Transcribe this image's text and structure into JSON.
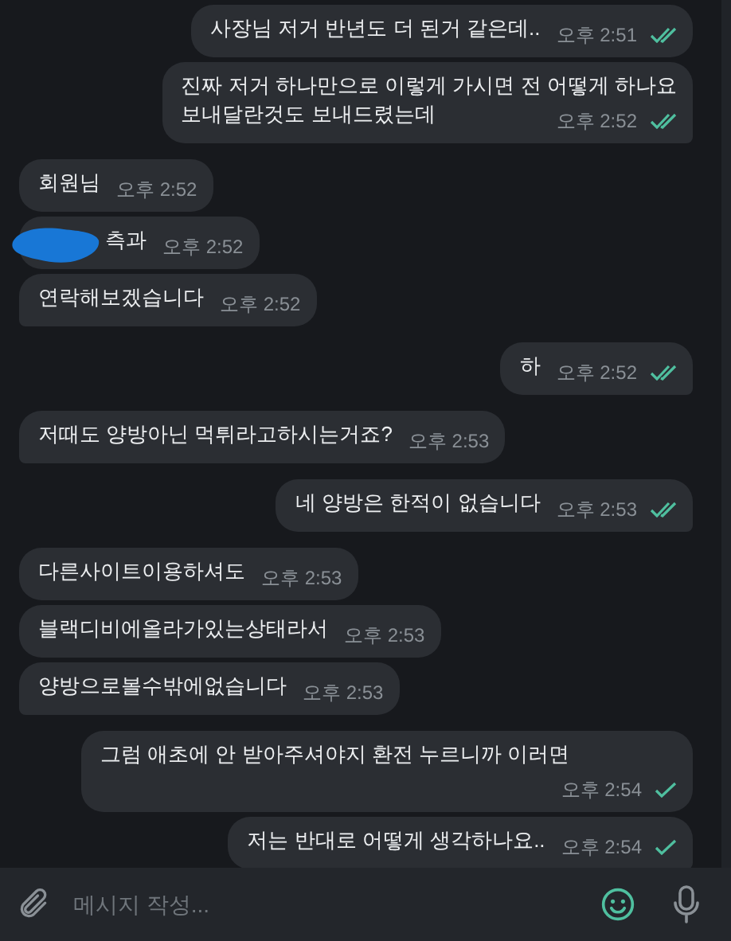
{
  "messages": [
    {
      "outgoing": true,
      "text": "사장님 저거 반년도 더 된거 같은데..",
      "time": "오후 2:51",
      "read": true
    },
    {
      "outgoing": true,
      "text": "진짜 저거 하나만으로 이렇게 가시면 전 어떻게 하나요\n보내달란것도 보내드렸는데",
      "time": "오후 2:52",
      "read": true
    },
    {
      "outgoing": false,
      "text": "회원님",
      "time": "오후 2:52"
    },
    {
      "outgoing": false,
      "text": "측과",
      "time": "오후 2:52",
      "redacted": true
    },
    {
      "outgoing": false,
      "text": "연락해보겠습니다",
      "time": "오후 2:52"
    },
    {
      "outgoing": true,
      "text": "하",
      "time": "오후 2:52",
      "read": true
    },
    {
      "outgoing": false,
      "text": "저때도 양방아닌 먹튀라고하시는거죠?",
      "time": "오후 2:53"
    },
    {
      "outgoing": true,
      "text": "네 양방은 한적이 없습니다",
      "time": "오후 2:53",
      "read": true
    },
    {
      "outgoing": false,
      "text": "다른사이트이용하셔도",
      "time": "오후 2:53"
    },
    {
      "outgoing": false,
      "text": "블랙디비에올라가있는상태라서",
      "time": "오후 2:53"
    },
    {
      "outgoing": false,
      "text": "양방으로볼수밖에없습니다",
      "time": "오후 2:53"
    },
    {
      "outgoing": true,
      "text": "그럼 애초에 안 받아주셔야지 환전 누르니까 이러면",
      "time": "오후 2:54",
      "read": false
    },
    {
      "outgoing": true,
      "text": "저는 반대로 어떻게 생각하나요..",
      "time": "오후 2:54",
      "read": false
    }
  ],
  "composer": {
    "placeholder": "메시지 작성..."
  }
}
